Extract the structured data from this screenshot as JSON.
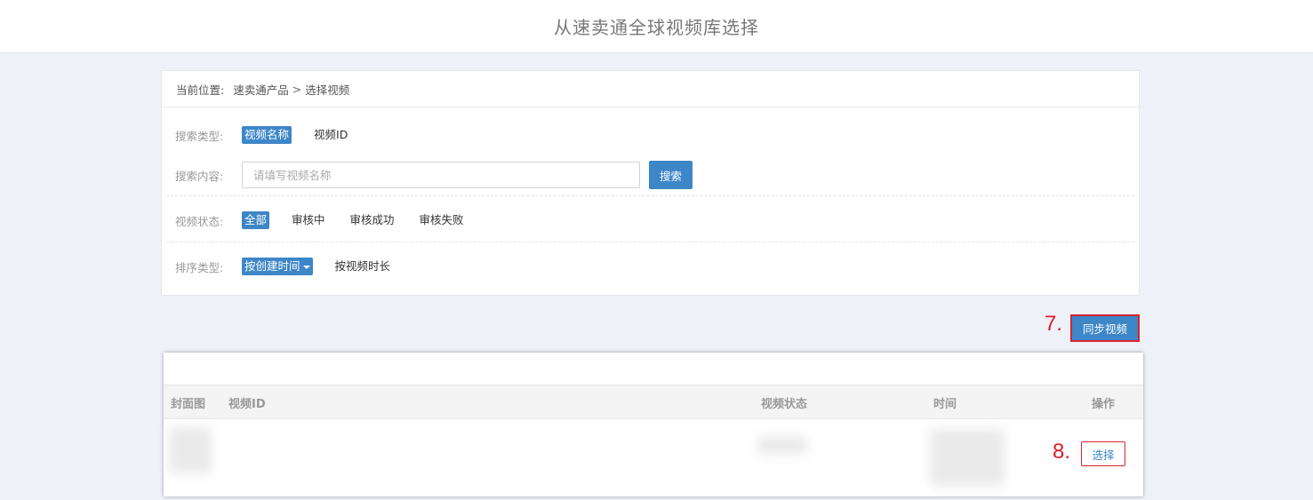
{
  "header": {
    "title": "从速卖通全球视频库选择"
  },
  "breadcrumb": {
    "prefix": "当前位置:",
    "parent": "速卖通产品",
    "separator": ">",
    "current": "选择视频"
  },
  "filters": {
    "search_type": {
      "label": "搜索类型:",
      "options": [
        "视频名称",
        "视频ID"
      ],
      "selected": "视频名称"
    },
    "search_content": {
      "label": "搜索内容:",
      "placeholder": "请填写视频名称",
      "button": "搜索"
    },
    "video_status": {
      "label": "视频状态:",
      "options": [
        "全部",
        "审核中",
        "审核成功",
        "审核失败"
      ],
      "selected": "全部"
    },
    "sort_type": {
      "label": "排序类型:",
      "options": [
        "按创建时间",
        "按视频时长"
      ],
      "selected": "按创建时间"
    }
  },
  "annotations": {
    "step7": "7.",
    "step8": "8."
  },
  "actions": {
    "sync_button": "同步视频"
  },
  "table": {
    "columns": [
      "封面图",
      "视频ID",
      "视频状态",
      "时间",
      "操作"
    ],
    "rows": [
      {
        "action": "选择"
      }
    ]
  },
  "colors": {
    "accent": "#3d86c8",
    "highlight": "#d9232d",
    "background": "#eef1f8"
  }
}
